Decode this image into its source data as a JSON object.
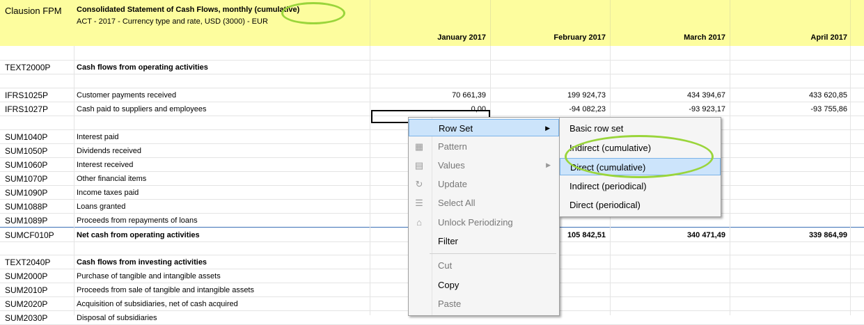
{
  "header": {
    "app_name": "Clausion FPM",
    "report_title": "Consolidated Statement of Cash Flows, monthly (cumulative)",
    "report_subtitle": "ACT - 2017 - Currency type and rate, USD (3000) - EUR",
    "columns": [
      "January 2017",
      "February 2017",
      "March 2017",
      "April 2017"
    ]
  },
  "rows": [
    {
      "code": "",
      "desc": "",
      "bold": false,
      "values": [
        "",
        "",
        "",
        ""
      ]
    },
    {
      "code": "TEXT2000P",
      "desc": "Cash flows from operating activities",
      "bold": true,
      "values": [
        "",
        "",
        "",
        ""
      ]
    },
    {
      "code": "",
      "desc": "",
      "bold": false,
      "values": [
        "",
        "",
        "",
        ""
      ]
    },
    {
      "code": "IFRS1025P",
      "desc": "Customer payments received",
      "bold": false,
      "values": [
        "70 661,39",
        "199 924,73",
        "434 394,67",
        "433 620,85"
      ]
    },
    {
      "code": "IFRS1027P",
      "desc": "Cash paid to suppliers and employees",
      "bold": false,
      "values": [
        "0,00",
        "-94 082,23",
        "-93 923,17",
        "-93 755,86"
      ]
    },
    {
      "code": "",
      "desc": "",
      "bold": false,
      "values": [
        "",
        "",
        "",
        ""
      ]
    },
    {
      "code": "SUM1040P",
      "desc": "Interest paid",
      "bold": false,
      "values": [
        "",
        "",
        "",
        ""
      ]
    },
    {
      "code": "SUM1050P",
      "desc": "Dividends received",
      "bold": false,
      "values": [
        "",
        "",
        "",
        ""
      ]
    },
    {
      "code": "SUM1060P",
      "desc": "Interest received",
      "bold": false,
      "values": [
        "",
        "",
        "",
        ""
      ]
    },
    {
      "code": "SUM1070P",
      "desc": "Other financial items",
      "bold": false,
      "values": [
        "",
        "",
        "",
        ""
      ]
    },
    {
      "code": "SUM1090P",
      "desc": "Income taxes paid",
      "bold": false,
      "values": [
        "",
        "",
        "",
        ""
      ]
    },
    {
      "code": "SUM1088P",
      "desc": "Loans granted",
      "bold": false,
      "values": [
        "",
        "",
        "",
        ""
      ]
    },
    {
      "code": "SUM1089P",
      "desc": "Proceeds from repayments of loans",
      "bold": false,
      "values": [
        "",
        "",
        "",
        ""
      ]
    },
    {
      "code": "SUMCF010P",
      "desc": "Net cash from operating activities",
      "bold": true,
      "values": [
        "",
        "105 842,51",
        "340 471,49",
        "339 864,99"
      ]
    },
    {
      "code": "",
      "desc": "",
      "bold": false,
      "values": [
        "",
        "",
        "",
        ""
      ]
    },
    {
      "code": "TEXT2040P",
      "desc": "Cash flows from investing activities",
      "bold": true,
      "values": [
        "",
        "",
        "",
        ""
      ]
    },
    {
      "code": "SUM2000P",
      "desc": "Purchase of tangible and intangible assets",
      "bold": false,
      "values": [
        "",
        "",
        "",
        ""
      ]
    },
    {
      "code": "SUM2010P",
      "desc": "Proceeds from sale of tangible and intangible assets",
      "bold": false,
      "values": [
        "",
        "",
        "",
        ""
      ]
    },
    {
      "code": "SUM2020P",
      "desc": "Acquisition of subsidiaries, net of cash acquired",
      "bold": false,
      "values": [
        "",
        "",
        "",
        ""
      ]
    },
    {
      "code": "SUM2030P",
      "desc": "Disposal of subsidiaries",
      "bold": false,
      "values": [
        "",
        "",
        "",
        ""
      ]
    }
  ],
  "context_menu": {
    "items": [
      {
        "label": "Row Set",
        "icon": "",
        "disabled": false,
        "submenu": true
      },
      {
        "label": "Pattern",
        "icon": "pattern-icon",
        "disabled": true,
        "submenu": false
      },
      {
        "label": "Values",
        "icon": "values-icon",
        "disabled": true,
        "submenu": true
      },
      {
        "label": "Update",
        "icon": "update-icon",
        "disabled": true,
        "submenu": false
      },
      {
        "label": "Select All",
        "icon": "select-all-icon",
        "disabled": true,
        "submenu": false
      },
      {
        "label": "Unlock Periodizing",
        "icon": "unlock-icon",
        "disabled": true,
        "submenu": false
      },
      {
        "label": "Filter",
        "icon": "",
        "disabled": false,
        "submenu": false
      },
      {
        "label": "Cut",
        "icon": "",
        "disabled": true,
        "submenu": false
      },
      {
        "label": "Copy",
        "icon": "",
        "disabled": false,
        "submenu": false
      },
      {
        "label": "Paste",
        "icon": "",
        "disabled": true,
        "submenu": false
      }
    ]
  },
  "row_set_submenu": {
    "items": [
      "Basic row set",
      "Indirect (cumulative)",
      "Direct (cumulative)",
      "Indirect (periodical)",
      "Direct (periodical)"
    ],
    "selected": "Direct (cumulative)"
  },
  "colors": {
    "header_bg": "#fdfd9e",
    "highlight_ring": "#9ad53b",
    "menu_hover": "#cce4fb",
    "total_rule": "#3b6fb5"
  }
}
